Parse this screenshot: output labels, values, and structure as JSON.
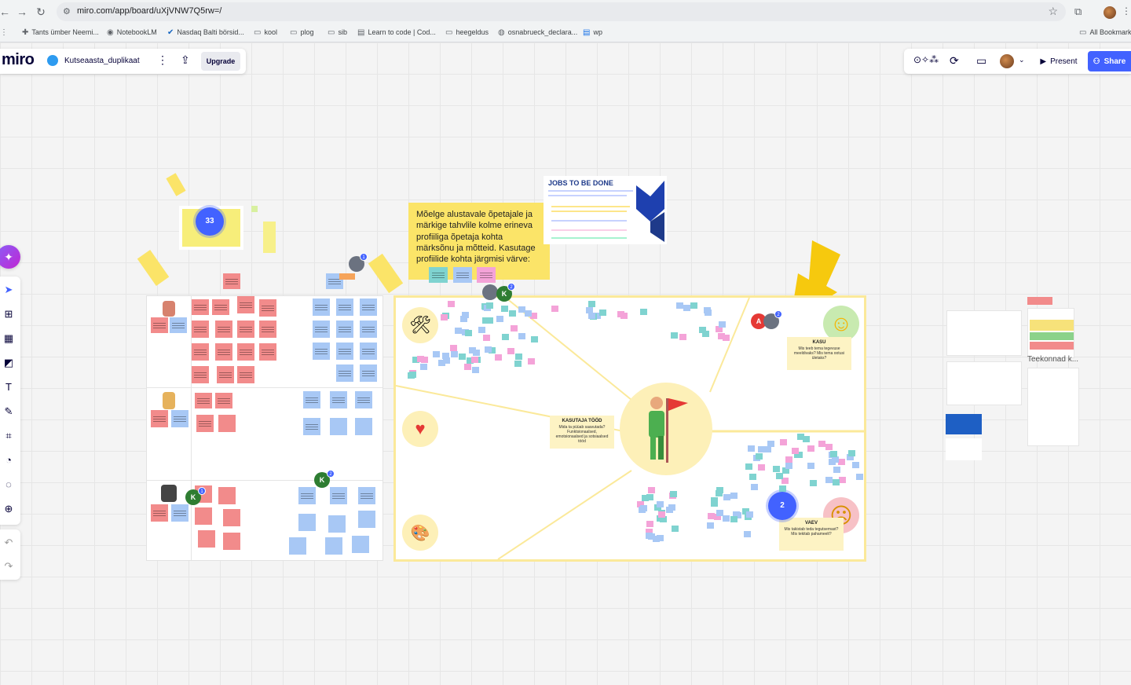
{
  "browser": {
    "url": "miro.com/app/board/uXjVNW7Q5rw=/",
    "bookmarks": [
      {
        "label": "Tants ümber Neemi..."
      },
      {
        "label": "NotebookLM"
      },
      {
        "label": "Nasdaq Balti börsid..."
      },
      {
        "label": "kool"
      },
      {
        "label": "plog"
      },
      {
        "label": "sib"
      },
      {
        "label": "Learn to code | Cod..."
      },
      {
        "label": "heegeldus"
      },
      {
        "label": "osnabrueck_declara..."
      },
      {
        "label": "wp"
      },
      {
        "label": "All Bookmarks"
      }
    ]
  },
  "topbar": {
    "logo": "miro",
    "board_title": "Kutseaasta_duplikaat",
    "upgrade_label": "Upgrade",
    "present_label": "Present",
    "share_label": "Share"
  },
  "board": {
    "instruction_text": "Mõelge alustavale õpetajale ja märkige tahvlile kolme erineva profiiliga õpetaja kohta märksõnu ja mõtteid. Kasutage profiilide kohta järgmisi värve:",
    "jtbd_title": "JOBS TO BE DONE",
    "kasutaja_title": "KASUTAJA TÖÖD",
    "kasutaja_sub": "Mida ta püüab saavutada? Funktsionaalsed, emotsionaalsed ja sotsiaalsed tööd",
    "kasu_title": "KASU",
    "kasu_sub": "Mis teeb tema tegevuse meeldivaks? Mis tema ootusi ületaks?",
    "vaev_title": "VAEV",
    "vaev_sub": "Mis takistab teda tegutsemast? Mis tekitab pahameelt?",
    "teekonnad_label": "Teekonnad k...",
    "cluster_counts": {
      "left": "33",
      "right": "2"
    },
    "user_badges": [
      {
        "letter": "K",
        "count": "1",
        "color": "#2e7d32"
      },
      {
        "letter": "K",
        "count": "2",
        "color": "#2e7d32"
      },
      {
        "letter": "K",
        "count": "2",
        "color": "#2e7d32"
      },
      {
        "letter": "A",
        "count": "2",
        "color": "#e53935"
      }
    ],
    "colors": {
      "pink": "#f28b8b",
      "blue": "#a8c8f5",
      "yellow": "#fbe468",
      "teal": "#7fd3d0",
      "magenta": "#f4a3d8"
    }
  }
}
